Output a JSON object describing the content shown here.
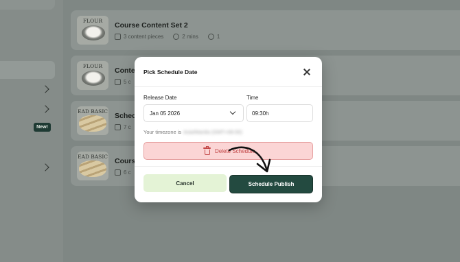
{
  "sidebar": {
    "badge": "New!"
  },
  "courses": [
    {
      "thumb_label": "FLOUR",
      "title": "Course Content Set 2",
      "pieces": "3 content pieces",
      "duration": "2 mins",
      "count": "1"
    },
    {
      "thumb_label": "FLOUR",
      "title": "Conte",
      "pieces": "5 c"
    },
    {
      "thumb_label": "EAD BASIC",
      "title": "Schedu",
      "pieces": "7 c"
    },
    {
      "thumb_label": "EAD BASIC",
      "title": "Course",
      "pieces": "6 c"
    }
  ],
  "modal": {
    "title": "Pick Schedule Date",
    "release_date_label": "Release Date",
    "release_date_value": "Jan 05 2026",
    "time_label": "Time",
    "time_value": "09:30h",
    "timezone_prefix": "Your timezone is",
    "timezone_value": "Asia/Manila (GMT+08:00)",
    "delete_label": "Delete Schedule",
    "cancel_label": "Cancel",
    "publish_label": "Schedule Publish"
  },
  "colors": {
    "primary": "#234a40",
    "danger": "#c24646",
    "cancel_bg": "#e4f3d6"
  }
}
